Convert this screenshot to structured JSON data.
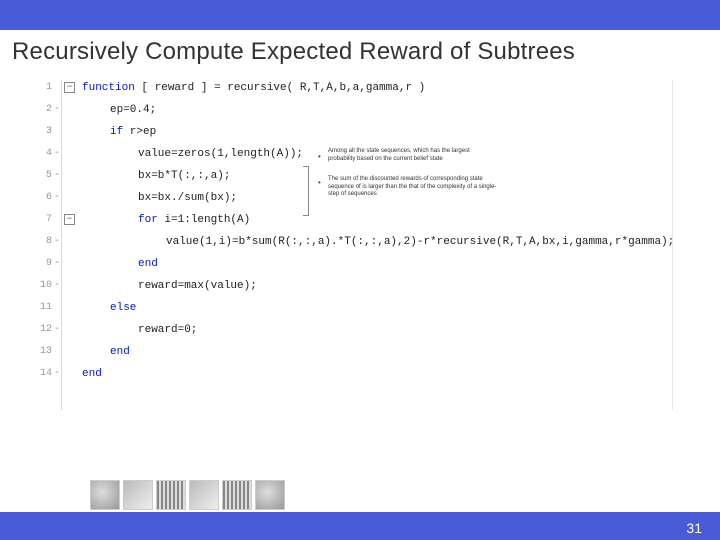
{
  "title": "Recursively Compute Expected Reward of Subtrees",
  "page_number": "31",
  "fold_glyph_1": "−",
  "fold_glyph_7": "−",
  "lines": [
    {
      "n": "1",
      "indent": 0,
      "minus": false,
      "text_pre": "",
      "kw": "function",
      "text_post": " [ reward ] = recursive( R,T,A,b,a,gamma,r )"
    },
    {
      "n": "2",
      "indent": 28,
      "minus": true,
      "text_pre": "ep=0.4;",
      "kw": "",
      "text_post": ""
    },
    {
      "n": "3",
      "indent": 28,
      "minus": false,
      "text_pre": "",
      "kw": "if",
      "text_post": " r>ep"
    },
    {
      "n": "4",
      "indent": 56,
      "minus": true,
      "text_pre": "value=zeros(1,length(A));",
      "kw": "",
      "text_post": ""
    },
    {
      "n": "5",
      "indent": 56,
      "minus": true,
      "text_pre": "bx=b*T(:,:,a);",
      "kw": "",
      "text_post": ""
    },
    {
      "n": "6",
      "indent": 56,
      "minus": true,
      "text_pre": "bx=bx./sum(bx);",
      "kw": "",
      "text_post": ""
    },
    {
      "n": "7",
      "indent": 56,
      "minus": false,
      "text_pre": "",
      "kw": "for",
      "text_post": " i=1:length(A)"
    },
    {
      "n": "8",
      "indent": 84,
      "minus": true,
      "text_pre": "value(1,i)=b*sum(R(:,:,a).*T(:,:,a),2)-r*recursive(R,T,A,bx,i,gamma,r*gamma);",
      "kw": "",
      "text_post": ""
    },
    {
      "n": "9",
      "indent": 56,
      "minus": true,
      "text_pre": "",
      "kw": "end",
      "text_post": ""
    },
    {
      "n": "10",
      "indent": 56,
      "minus": true,
      "text_pre": "reward=max(value);",
      "kw": "",
      "text_post": ""
    },
    {
      "n": "11",
      "indent": 28,
      "minus": false,
      "text_pre": "",
      "kw": "else",
      "text_post": ""
    },
    {
      "n": "12",
      "indent": 56,
      "minus": true,
      "text_pre": "reward=0;",
      "kw": "",
      "text_post": ""
    },
    {
      "n": "13",
      "indent": 28,
      "minus": false,
      "text_pre": "",
      "kw": "end",
      "text_post": ""
    },
    {
      "n": "14",
      "indent": 0,
      "minus": true,
      "text_pre": "",
      "kw": "end",
      "text_post": ""
    }
  ],
  "annotation1": "Among all the state sequences, which has the largest probability based on the current belief state",
  "annotation2": "The sum of the discounted rewards of corresponding state sequence of is larger than the that of the complexity of a single-step of sequences"
}
